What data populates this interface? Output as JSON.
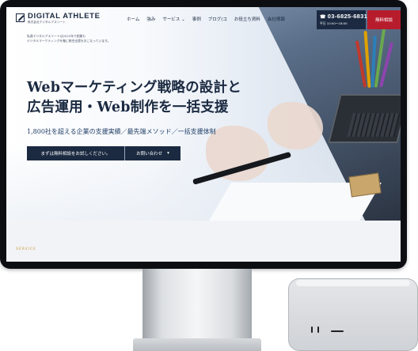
{
  "header": {
    "logo_name": "DIGITAL ATHLETE",
    "logo_sub": "株式会社デジタルアスリート",
    "nav": [
      "ホーム",
      "強み",
      "サービス ⌄",
      "事例",
      "ブログ(コ",
      "お役立ち資料",
      "会社情報"
    ],
    "phone_icon": "phone-icon",
    "phone_number": "03-6825-6831",
    "phone_hours": "平日 10:00〜18:00",
    "consult_label": "無料相談"
  },
  "hero": {
    "intro_line1": "私達デジタルアスリートは2022年で創業も",
    "intro_line2": "デジタルマーケティングを軸に総合支援をおこなっています。",
    "headline_line1": "Webマーケティング戦略の設計と",
    "headline_line2": "広告運用・Web制作を一括支援",
    "subheadline": "1,800社を超える企業の支援実績／最先端メソッド／一括支援体制",
    "cta_main": "まずは無料相談をお試しください。",
    "cta_contact": "お問い合わせ",
    "cta_contact_icon": "chevron-down-icon"
  },
  "section": {
    "service_label": "SERVICE"
  },
  "colors": {
    "navy": "#1b2a41",
    "brand_red": "#b71c2d",
    "gold": "#c59b3f"
  }
}
